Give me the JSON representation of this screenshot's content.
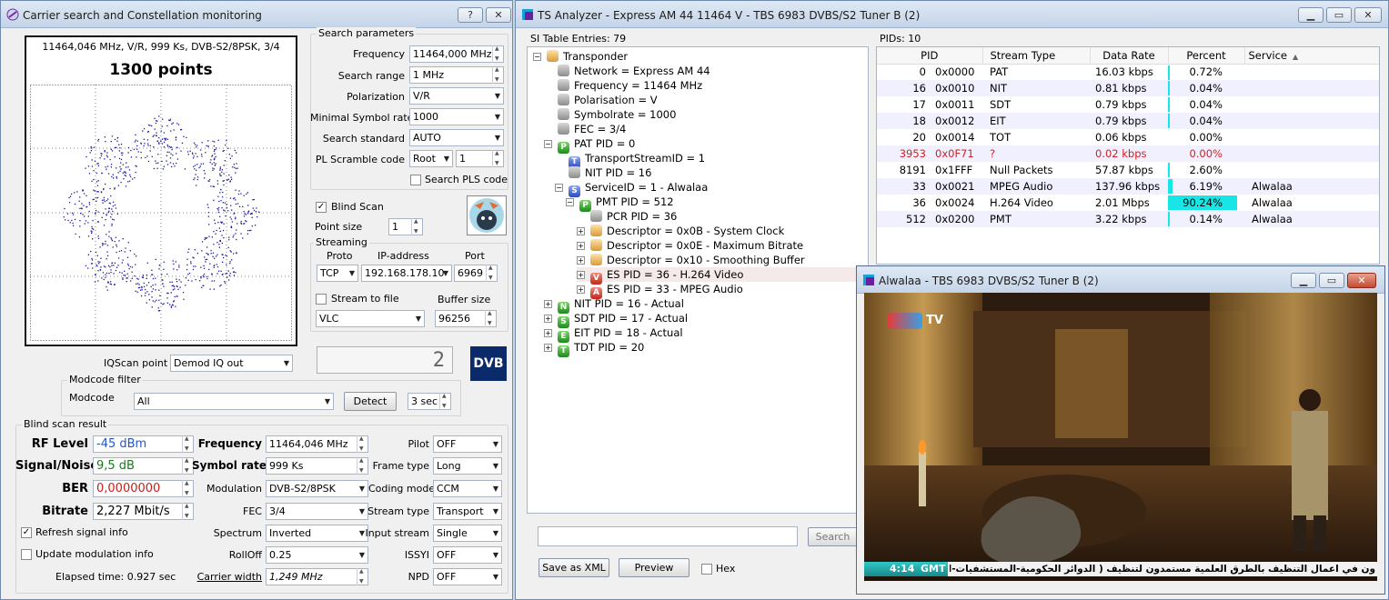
{
  "left": {
    "title": "Carrier search and Constellation monitoring",
    "help_btn": "?",
    "close_btn": "✕",
    "plot_header": "11464,046 MHz, V/R, 999 Ks, DVB-S2/8PSK, 3/4",
    "plot_points": "1300 points",
    "search_params": {
      "group": "Search parameters",
      "frequency_label": "Frequency",
      "frequency": "11464,000 MHz",
      "range_label": "Search range",
      "range": "1 MHz",
      "pol_label": "Polarization",
      "pol": "V/R",
      "minsym_label": "Minimal Symbol rate",
      "minsym": "1000",
      "std_label": "Search standard",
      "std": "AUTO",
      "pls_label": "PL Scramble code",
      "pls_mode": "Root",
      "pls_val": "1",
      "search_pls": "Search PLS code"
    },
    "blind_scan": "Blind Scan",
    "point_size_label": "Point size",
    "point_size": "1",
    "streaming": {
      "group": "Streaming",
      "proto_h": "Proto",
      "ip_h": "IP-address",
      "port_h": "Port",
      "proto": "TCP",
      "ip": "192.168.178.10",
      "port": "6969",
      "stream_to_file": "Stream to file",
      "buffer_label": "Buffer size",
      "player": "VLC",
      "buffer": "96256"
    },
    "iq_label": "IQScan point",
    "iq_value": "Demod IQ out",
    "counter": "2",
    "dvb_logo": "DVB",
    "modcode": {
      "group": "Modcode filter",
      "label": "Modcode",
      "value": "All",
      "detect": "Detect",
      "sec": "3 sec"
    },
    "result": {
      "group": "Blind scan result",
      "rf_label": "RF Level",
      "rf": "-45 dBm",
      "sn_label": "Signal/Noise",
      "sn": "9,5 dB",
      "ber_label": "BER",
      "ber": "0,0000000",
      "bitrate_label": "Bitrate",
      "bitrate": "2,227 Mbit/s",
      "freq_label": "Frequency",
      "freq": "11464,046 MHz",
      "sym_label": "Symbol rate",
      "sym": "999 Ks",
      "mod_label": "Modulation",
      "mod": "DVB-S2/8PSK",
      "fec_label": "FEC",
      "fec": "3/4",
      "spec_label": "Spectrum",
      "spec": "Inverted",
      "roll_label": "RollOff",
      "roll": "0.25",
      "cw_label": "Carrier width",
      "cw": "1,249 MHz",
      "pilot_label": "Pilot",
      "pilot": "OFF",
      "frame_label": "Frame type",
      "frame": "Long",
      "coding_label": "Coding mode",
      "coding": "CCM",
      "stype_label": "Stream type",
      "stype": "Transport",
      "istream_label": "Input stream",
      "istream": "Single",
      "issyi_label": "ISSYI",
      "issyi": "OFF",
      "npd_label": "NPD",
      "npd": "OFF",
      "refresh": "Refresh signal info",
      "update_mod": "Update modulation info",
      "elapsed": "Elapsed time: 0.927 sec"
    }
  },
  "ts": {
    "title": "TS Analyzer - Express AM 44 11464 V - TBS 6983 DVBS/S2 Tuner B (2)",
    "si_header": "SI Table Entries: 79",
    "pids_header": "PIDs: 10",
    "tree": [
      {
        "t": "Transponder",
        "icon": "",
        "c": "yel",
        "tog": "−"
      },
      {
        "t": "Network = Express AM 44",
        "icon": "",
        "c": "grey",
        "tog": ""
      },
      {
        "t": "Frequency = 11464 MHz",
        "icon": "",
        "c": "grey",
        "tog": ""
      },
      {
        "t": "Polarisation = V",
        "icon": "",
        "c": "grey",
        "tog": ""
      },
      {
        "t": "Symbolrate = 1000",
        "icon": "",
        "c": "grey",
        "tog": ""
      },
      {
        "t": "FEC = 3/4",
        "icon": "",
        "c": "grey",
        "tog": ""
      },
      {
        "t": "PAT PID = 0",
        "icon": "P",
        "c": "grn",
        "tog": "−"
      },
      {
        "t": "TransportStreamID = 1",
        "icon": "T",
        "c": "blu",
        "tog": ""
      },
      {
        "t": "NIT PID = 16",
        "icon": "",
        "c": "grey",
        "tog": ""
      },
      {
        "t": "ServiceID = 1 - Alwalaa",
        "icon": "S",
        "c": "blu",
        "tog": "−"
      },
      {
        "t": "PMT PID = 512",
        "icon": "P",
        "c": "grn",
        "tog": "−"
      },
      {
        "t": "PCR PID = 36",
        "icon": "",
        "c": "grey",
        "tog": ""
      },
      {
        "t": "Descriptor = 0x0B - System Clock",
        "icon": "",
        "c": "yel",
        "tog": "+"
      },
      {
        "t": "Descriptor = 0x0E - Maximum Bitrate",
        "icon": "",
        "c": "yel",
        "tog": "+"
      },
      {
        "t": "Descriptor = 0x10 - Smoothing Buffer",
        "icon": "",
        "c": "yel",
        "tog": "+"
      },
      {
        "t": "ES PID = 36 - H.264 Video",
        "icon": "V",
        "c": "redn",
        "tog": "+"
      },
      {
        "t": "ES PID = 33 - MPEG Audio",
        "icon": "A",
        "c": "redn",
        "tog": "+"
      },
      {
        "t": "NIT PID = 16 - Actual",
        "icon": "N",
        "c": "grn",
        "tog": "+"
      },
      {
        "t": "SDT PID = 17 - Actual",
        "icon": "S",
        "c": "grn",
        "tog": "+"
      },
      {
        "t": "EIT PID = 18 - Actual",
        "icon": "E",
        "c": "grn",
        "tog": "+"
      },
      {
        "t": "TDT PID = 20",
        "icon": "T",
        "c": "grn",
        "tog": "+"
      }
    ],
    "columns": [
      "PID",
      "Stream Type",
      "Data Rate",
      "Percent",
      "Service"
    ],
    "rows": [
      {
        "pid": "0",
        "hex": "0x0000",
        "type": "PAT",
        "rate": "16.03 kbps",
        "pct": "0.72%",
        "pv": 0.72,
        "svc": "",
        "warn": false
      },
      {
        "pid": "16",
        "hex": "0x0010",
        "type": "NIT",
        "rate": "0.81 kbps",
        "pct": "0.04%",
        "pv": 0.04,
        "svc": "",
        "warn": false
      },
      {
        "pid": "17",
        "hex": "0x0011",
        "type": "SDT",
        "rate": "0.79 kbps",
        "pct": "0.04%",
        "pv": 0.04,
        "svc": "",
        "warn": false
      },
      {
        "pid": "18",
        "hex": "0x0012",
        "type": "EIT",
        "rate": "0.79 kbps",
        "pct": "0.04%",
        "pv": 0.04,
        "svc": "",
        "warn": false
      },
      {
        "pid": "20",
        "hex": "0x0014",
        "type": "TOT",
        "rate": "0.06 kbps",
        "pct": "0.00%",
        "pv": 0,
        "svc": "",
        "warn": false
      },
      {
        "pid": "3953",
        "hex": "0x0F71",
        "type": "?",
        "rate": "0.02 kbps",
        "pct": "0.00%",
        "pv": 0,
        "svc": "",
        "warn": true
      },
      {
        "pid": "8191",
        "hex": "0x1FFF",
        "type": "Null Packets",
        "rate": "57.87 kbps",
        "pct": "2.60%",
        "pv": 2.6,
        "svc": "",
        "warn": false
      },
      {
        "pid": "33",
        "hex": "0x0021",
        "type": "MPEG Audio",
        "rate": "137.96 kbps",
        "pct": "6.19%",
        "pv": 6.19,
        "svc": "Alwalaa",
        "warn": false
      },
      {
        "pid": "36",
        "hex": "0x0024",
        "type": "H.264 Video",
        "rate": "2.01 Mbps",
        "pct": "90.24%",
        "pv": 90.24,
        "svc": "Alwalaa",
        "warn": false
      },
      {
        "pid": "512",
        "hex": "0x0200",
        "type": "PMT",
        "rate": "3.22 kbps",
        "pct": "0.14%",
        "pv": 0.14,
        "svc": "Alwalaa",
        "warn": false
      }
    ],
    "search_btn": "Search",
    "save_xml": "Save as XML",
    "preview": "Preview",
    "hex": "Hex"
  },
  "video": {
    "title": "Alwalaa - TBS 6983 DVBS/S2 Tuner B (2)",
    "logo": "TV",
    "time": "4:14",
    "gmt": "GMT",
    "ticker": "ون في اعمال التنظيف بالطرق العلمية مستمدون لتنظيف ( الدوائر الحكومية-المستشفيات-الفنادق-المولات التجارية"
  }
}
